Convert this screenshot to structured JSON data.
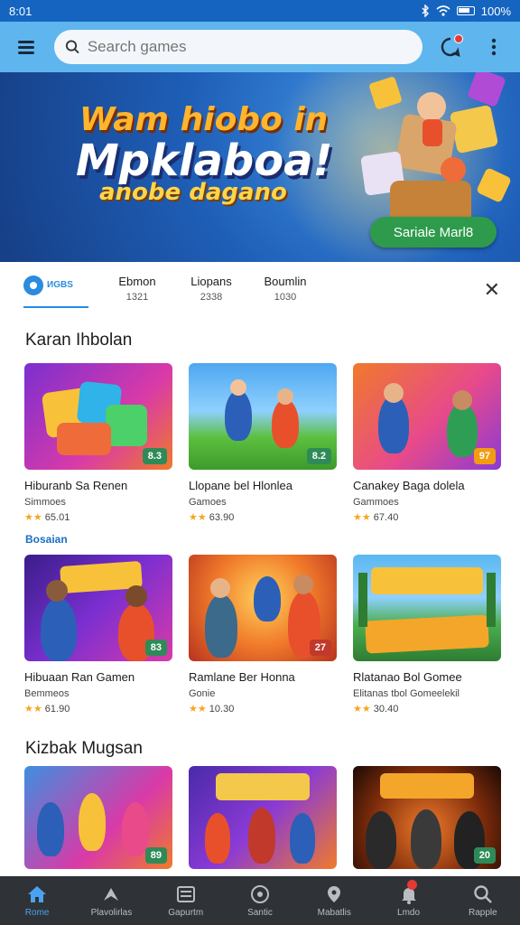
{
  "status": {
    "time": "8:01",
    "battery": "100%"
  },
  "header": {
    "search_placeholder": "Search games"
  },
  "banner": {
    "title_line1": "Wam hiobo in",
    "title_line2": "Mpklaboa!",
    "subtitle": "anobe dagano",
    "button_label": "Sariale Marl8"
  },
  "tabs": {
    "logo_text": "ИGBS",
    "items": [
      {
        "label": "Ebmon",
        "count": "1321"
      },
      {
        "label": "Liopans",
        "count": "2338"
      },
      {
        "label": "Boumlin",
        "count": "1030"
      }
    ]
  },
  "sections": [
    {
      "title": "Karan Ihbolan",
      "cards": [
        {
          "title": "Hiburanb Sa Renen",
          "subtitle": "Simmoes",
          "rating": "65.01",
          "badge": "8.3"
        },
        {
          "title": "Llopane bel Hlonlea",
          "subtitle": "Gamoes",
          "rating": "63.90",
          "badge": "8.2"
        },
        {
          "title": "Canakey Baga dolela",
          "subtitle": "Gammoes",
          "rating": "67.40",
          "badge": "97"
        }
      ]
    },
    {
      "label": "Bosaian",
      "cards": [
        {
          "title": "Hibuaan Ran Gamen",
          "subtitle": "Bemmeos",
          "rating": "61.90",
          "badge": "83"
        },
        {
          "title": "Ramlane Ber Honna",
          "subtitle": "Gonie",
          "rating": "10.30",
          "badge": "27"
        },
        {
          "title": "Rlatanao Bol Gomee",
          "subtitle": "Elitanas tbol Gomeelekil",
          "rating": "30.40",
          "badge": ""
        }
      ]
    },
    {
      "title": "Kizbak Mugsan",
      "cards": [
        {
          "badge": "89"
        },
        {
          "badge": ""
        },
        {
          "badge": "20"
        }
      ]
    }
  ],
  "nav": [
    {
      "label": "Rome",
      "icon": "home-icon"
    },
    {
      "label": "Plavolirlas",
      "icon": "games-icon"
    },
    {
      "label": "Gapurtm",
      "icon": "library-icon"
    },
    {
      "label": "Santic",
      "icon": "target-icon"
    },
    {
      "label": "Mabatlis",
      "icon": "map-pin-icon"
    },
    {
      "label": "Lmdo",
      "icon": "bell-icon"
    },
    {
      "label": "Rapple",
      "icon": "search-icon"
    }
  ],
  "colors": {
    "accent": "#5fb6ee",
    "brand": "#1565c0",
    "nav_bg": "#2f3338",
    "rating_chip": "#2e8b57"
  }
}
